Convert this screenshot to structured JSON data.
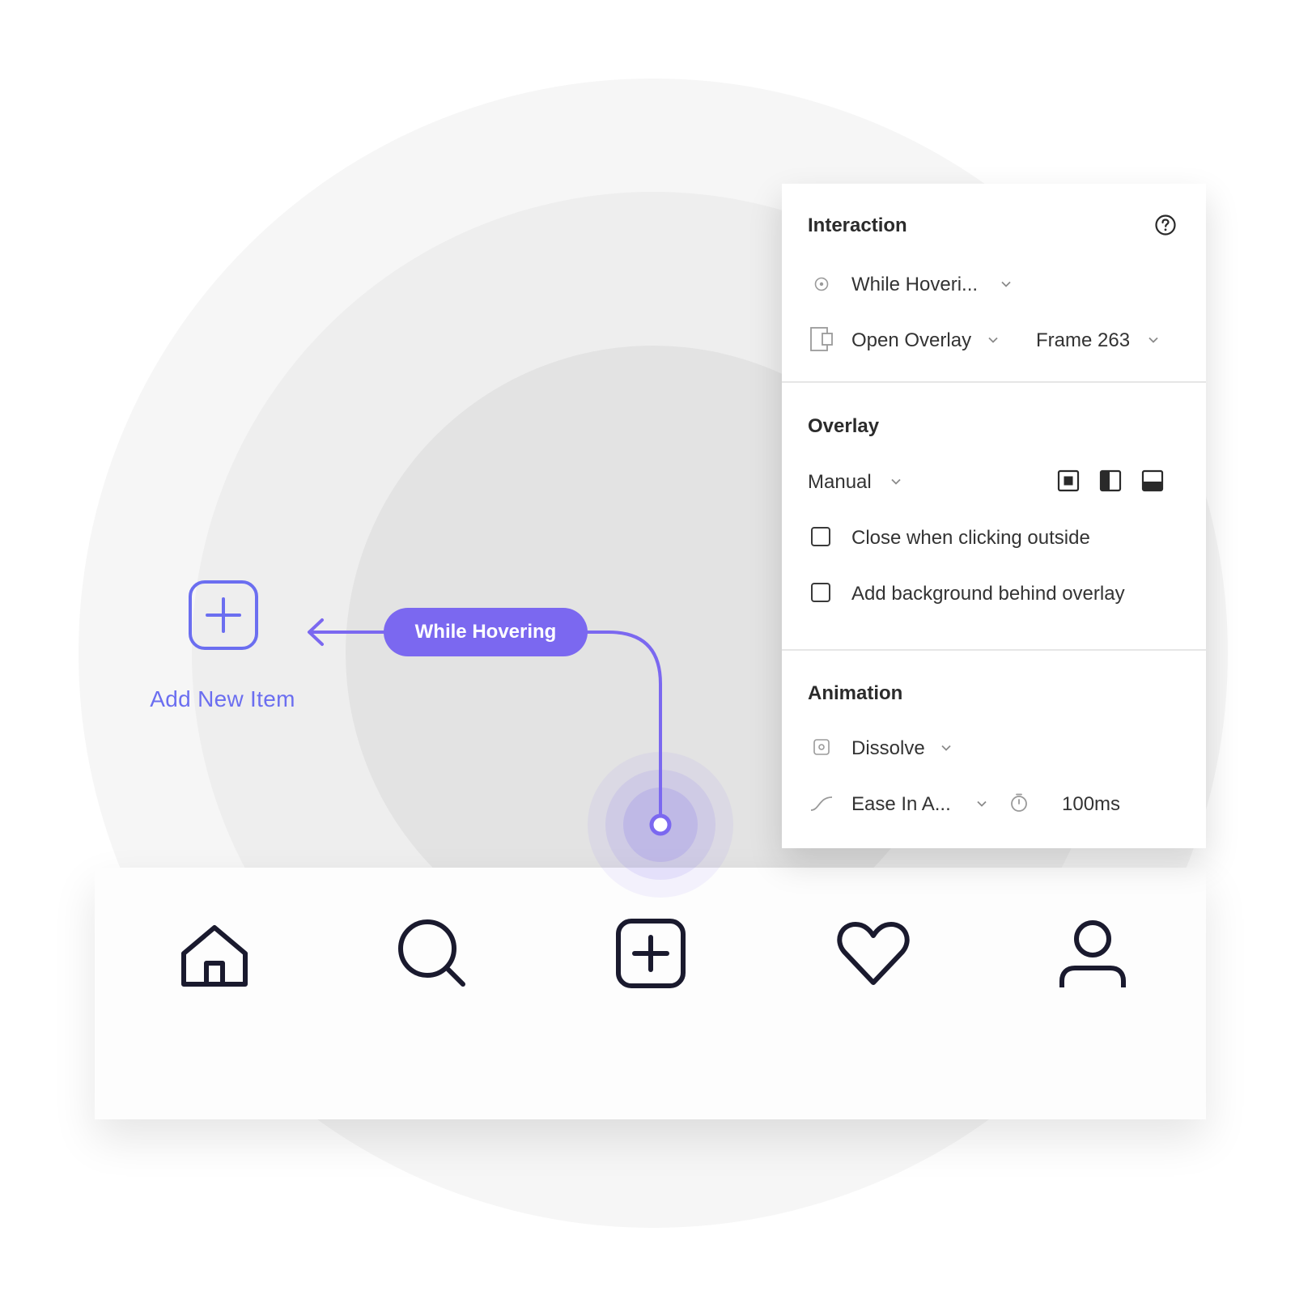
{
  "canvas": {
    "add_item_label": "Add New Item",
    "trigger_pill": "While Hovering"
  },
  "tabbar": {
    "items": [
      {
        "icon": "home-icon"
      },
      {
        "icon": "search-icon"
      },
      {
        "icon": "add-square-icon"
      },
      {
        "icon": "heart-icon"
      },
      {
        "icon": "user-icon"
      }
    ]
  },
  "panel": {
    "interaction": {
      "title": "Interaction",
      "trigger": "While Hoveri...",
      "action": "Open Overlay",
      "destination": "Frame 263"
    },
    "overlay": {
      "title": "Overlay",
      "position": "Manual",
      "close_outside_label": "Close when clicking outside",
      "close_outside_checked": false,
      "background_label": "Add background behind overlay",
      "background_checked": false
    },
    "animation": {
      "title": "Animation",
      "type": "Dissolve",
      "easing": "Ease In A...",
      "duration": "100ms"
    }
  },
  "colors": {
    "accent": "#7b68f0",
    "add_item": "#6b6ef0",
    "icon": "#1a1a2e"
  }
}
